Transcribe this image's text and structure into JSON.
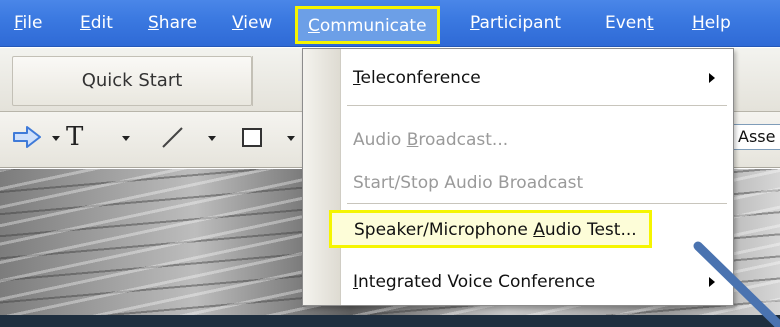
{
  "menubar": {
    "items": [
      {
        "pre": "",
        "mn": "F",
        "post": "ile"
      },
      {
        "pre": "",
        "mn": "E",
        "post": "dit"
      },
      {
        "pre": "",
        "mn": "S",
        "post": "hare"
      },
      {
        "pre": "",
        "mn": "V",
        "post": "iew"
      },
      {
        "pre": "",
        "mn": "C",
        "post": "ommunicate"
      },
      {
        "pre": "",
        "mn": "P",
        "post": "articipant"
      },
      {
        "pre": "Even",
        "mn": "t",
        "post": ""
      },
      {
        "pre": "",
        "mn": "H",
        "post": "elp"
      }
    ]
  },
  "toolbar": {
    "quick_start_label": "Quick Start",
    "text_tool_glyph": "T",
    "assets_partial": "Asse"
  },
  "dropdown": {
    "items": [
      {
        "pre": "",
        "mn": "T",
        "post": "eleconference",
        "enabled": true,
        "submenu": true
      },
      {
        "pre": "Audio ",
        "mn": "B",
        "post": "roadcast...",
        "enabled": false,
        "submenu": false
      },
      {
        "pre": "Start/Stop Audio Broadcast",
        "mn": "",
        "post": "",
        "enabled": false,
        "submenu": false
      },
      {
        "pre": "Speaker/Microphone ",
        "mn": "A",
        "post": "udio Test...",
        "enabled": true,
        "submenu": false,
        "highlighted": true
      },
      {
        "pre": "",
        "mn": "I",
        "post": "ntegrated Voice Conference",
        "enabled": true,
        "submenu": true
      }
    ]
  },
  "colors": {
    "menubar": "#3a78e0",
    "highlight_outline": "#f5f500",
    "annotation_arrow": "#4a73b0"
  },
  "icons": [
    "arrow-pointer-icon",
    "text-tool-icon",
    "line-tool-icon",
    "rectangle-tool-icon",
    "submenu-arrow-icon",
    "annotation-arrow-icon"
  ]
}
